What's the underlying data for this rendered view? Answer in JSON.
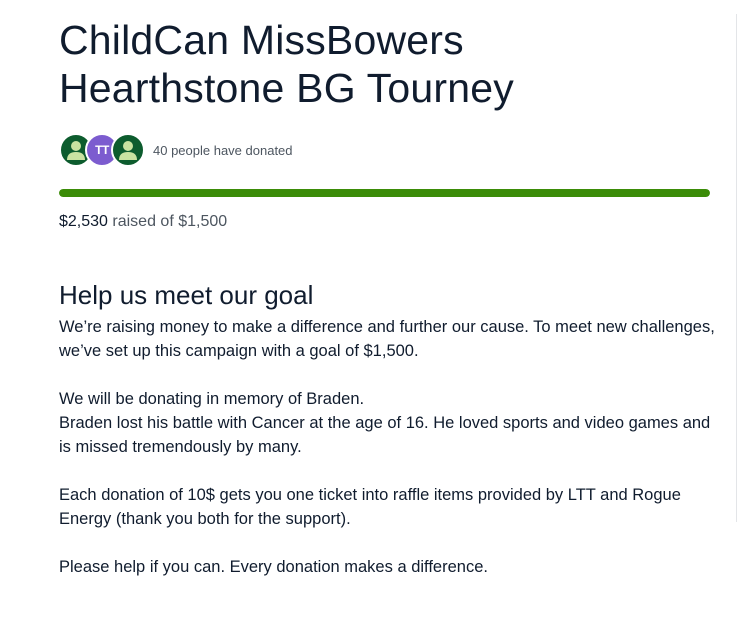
{
  "campaign": {
    "title": "ChildCan MissBowers Hearthstone BG Tourney"
  },
  "donors": {
    "avatars": [
      {
        "type": "person-icon",
        "color": "#0d5c2e"
      },
      {
        "type": "initials",
        "initials": "TT",
        "color": "#7c5ccf"
      },
      {
        "type": "person-icon",
        "color": "#0d5c2e"
      }
    ],
    "count_text": "40 people have donated"
  },
  "progress": {
    "raised": "$2,530",
    "raised_suffix": "raised of $1,500",
    "percent": 100,
    "color": "#3b8c08"
  },
  "story": {
    "heading": "Help us meet our goal",
    "paragraph_1": "We’re raising money to make a difference and further our cause. To meet new challenges, we’ve set up this campaign with a goal of $1,500.",
    "paragraph_2_line_1": "We will be donating in memory of Braden.",
    "paragraph_2_line_2": "Braden lost his battle with Cancer at the age of 16. He loved sports and video games and is missed tremendously by many.",
    "paragraph_3": "Each donation of 10$ gets you one ticket into raffle items provided by LTT and Rogue Energy (thank you both for the support).",
    "paragraph_4": "Please help if you can. Every donation makes a difference."
  }
}
